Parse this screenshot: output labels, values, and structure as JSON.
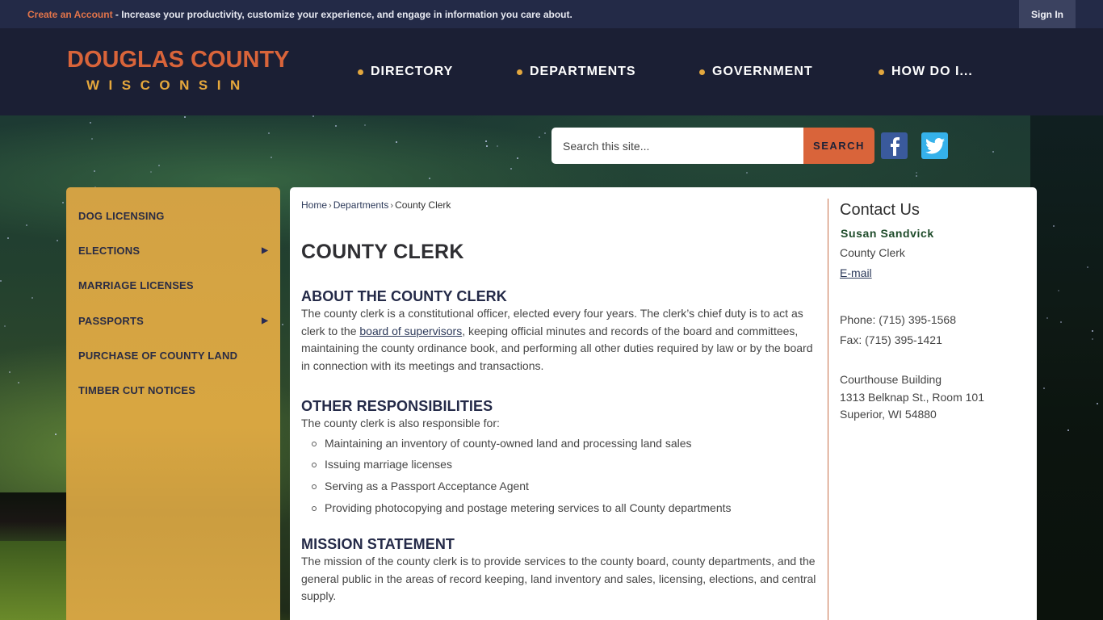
{
  "topbar": {
    "create_account_link": "Create an Account",
    "promo_text": " - Increase your productivity, customize your experience, and engage in information you care about.",
    "sign_in": "Sign In"
  },
  "logo": {
    "line1": "DOUGLAS COUNTY",
    "line2": "WISCONSIN"
  },
  "nav": {
    "items": [
      {
        "label": "DIRECTORY"
      },
      {
        "label": "DEPARTMENTS"
      },
      {
        "label": "GOVERNMENT"
      },
      {
        "label": "HOW DO I..."
      }
    ]
  },
  "search": {
    "placeholder": "Search this site...",
    "button": "SEARCH"
  },
  "social": {
    "facebook": "f",
    "twitter": "twitter"
  },
  "sidebar": {
    "items": [
      {
        "label": "DOG LICENSING",
        "has_submenu": false
      },
      {
        "label": "ELECTIONS",
        "has_submenu": true
      },
      {
        "label": "MARRIAGE LICENSES",
        "has_submenu": false
      },
      {
        "label": "PASSPORTS",
        "has_submenu": true
      },
      {
        "label": "PURCHASE OF COUNTY LAND",
        "has_submenu": false
      },
      {
        "label": "TIMBER CUT NOTICES",
        "has_submenu": false
      }
    ],
    "submenu_arrow": "▶"
  },
  "breadcrumb": {
    "items": [
      "Home",
      "Departments",
      "County Clerk"
    ],
    "separator": "›"
  },
  "page": {
    "title": "COUNTY CLERK",
    "sections": {
      "about": {
        "heading": "ABOUT THE COUNTY CLERK",
        "text_before_link": "The county clerk is a constitutional officer, elected every four years. The clerk’s chief duty is to act as clerk to the ",
        "link": "board of supervisors",
        "text_after_link": ", keeping official minutes and records of the board and committees, maintaining the county ordinance book, and performing all other duties required by law or by the board in connection with its meetings and transactions."
      },
      "other": {
        "heading": "OTHER RESPONSIBILITIES",
        "intro": "The county clerk is also responsible for:",
        "items": [
          "Maintaining an inventory of county-owned land and processing land sales",
          "Issuing marriage licenses",
          "Serving as a Passport Acceptance Agent",
          "Providing photocopying and postage metering services to all County departments"
        ]
      },
      "mission": {
        "heading": "MISSION STATEMENT",
        "text": "The mission of the county clerk is to provide services to the county board, county departments, and the general public in the areas of record keeping, land inventory and sales, licensing, elections, and central supply."
      }
    }
  },
  "contact": {
    "title": "Contact Us",
    "name": "Susan Sandvick",
    "role": "County Clerk",
    "email_label": "E-mail",
    "phone": "Phone: (715) 395-1568",
    "fax": "Fax: (715) 395-1421",
    "address": [
      "Courthouse Building",
      "1313 Belknap St., Room 101",
      "Superior, WI 54880"
    ]
  },
  "colors": {
    "topbar_bg": "#232a47",
    "header_bg": "#1b1f34",
    "brand_orange": "#d9643a",
    "brand_gold": "#e6a83c",
    "sidebar_bg": "#d6a443",
    "heading_navy": "#242a48",
    "facebook_blue": "#3a5a9c",
    "twitter_blue": "#35b1ea"
  }
}
